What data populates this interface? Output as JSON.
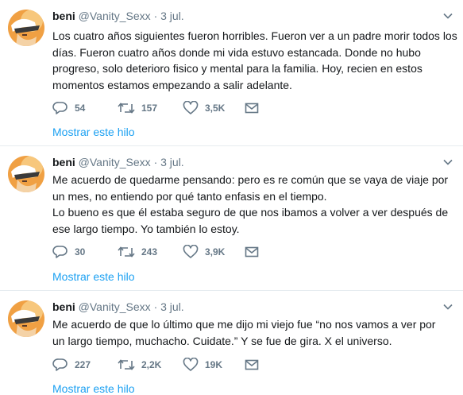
{
  "tweets": [
    {
      "name": "beni",
      "handle": "@Vanity_Sexx",
      "sep": "·",
      "date": "3 jul.",
      "text": "Los cuatro años siguientes fueron horribles. Fueron ver a un padre morir todos los\ndías. Fueron cuatro años donde mi vida estuvo estancada. Donde no hubo\nprogreso, solo deterioro fisico y mental para la familia. Hoy, recien en estos\nmomentos estamos empezando a salir adelante.",
      "replies": "54",
      "retweets": "157",
      "likes": "3,5K",
      "thread_link": "Mostrar este hilo"
    },
    {
      "name": "beni",
      "handle": "@Vanity_Sexx",
      "sep": "·",
      "date": "3 jul.",
      "text": "Me acuerdo de quedarme pensando: pero es re común que se vaya de viaje por\nun mes, no entiendo por qué tanto enfasis en el tiempo.\nLo bueno es que él estaba seguro de que nos ibamos a volver a ver después de\nese largo tiempo. Yo también lo estoy.",
      "replies": "30",
      "retweets": "243",
      "likes": "3,9K",
      "thread_link": "Mostrar este hilo"
    },
    {
      "name": "beni",
      "handle": "@Vanity_Sexx",
      "sep": "·",
      "date": "3 jul.",
      "text": "Me acuerdo de que lo último que me dijo mi viejo fue “no nos vamos a ver por\nun largo tiempo, muchacho. Cuidate.” Y se fue de gira. X el universo.",
      "replies": "227",
      "retweets": "2,2K",
      "likes": "19K",
      "thread_link": "Mostrar este hilo"
    }
  ],
  "icons": {
    "reply": "reply-icon",
    "retweet": "retweet-icon",
    "like": "heart-icon",
    "message": "envelope-icon",
    "caret": "chevron-down-icon"
  },
  "colors": {
    "link": "#1da1f2",
    "meta": "#657786",
    "text": "#14171a",
    "divider": "#e6ecf0"
  }
}
